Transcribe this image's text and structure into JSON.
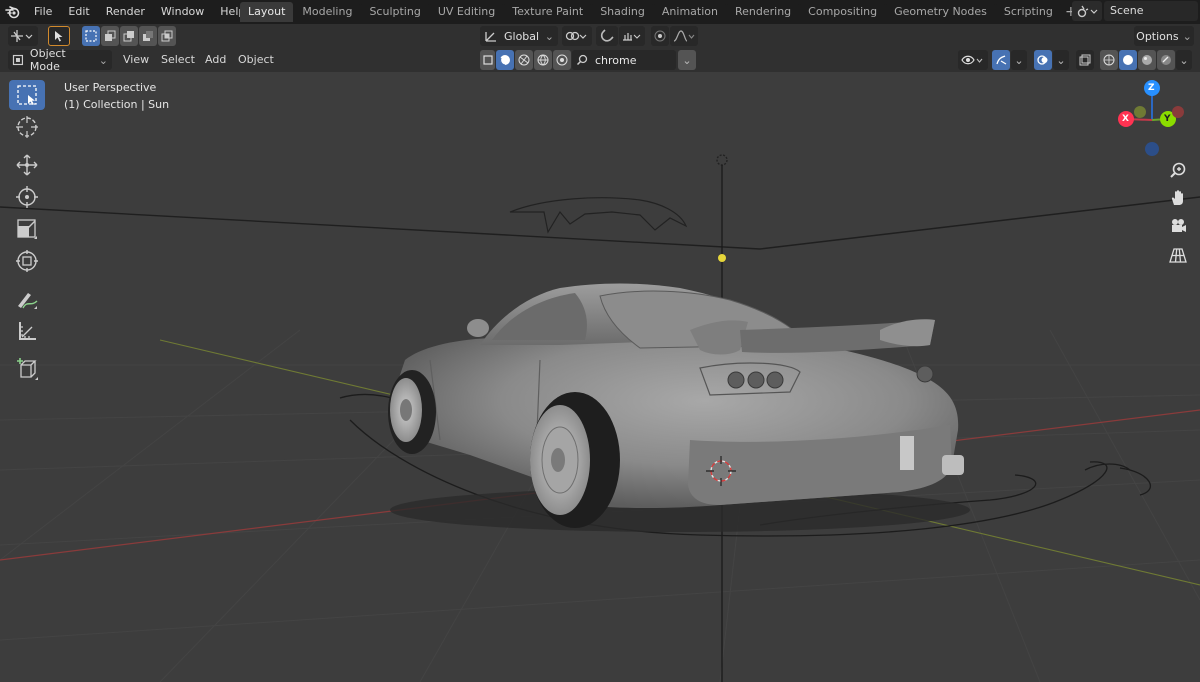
{
  "topbar": {
    "menus": [
      "File",
      "Edit",
      "Render",
      "Window",
      "Help"
    ],
    "tabs": [
      "Layout",
      "Modeling",
      "Sculpting",
      "UV Editing",
      "Texture Paint",
      "Shading",
      "Animation",
      "Rendering",
      "Compositing",
      "Geometry Nodes",
      "Scripting"
    ],
    "active_tab": "Layout",
    "add_tab": "+",
    "scene": "Scene"
  },
  "header": {
    "orientation": "Global",
    "options": "Options",
    "mode": "Object Mode",
    "menus": [
      "View",
      "Select",
      "Add",
      "Object"
    ],
    "search_value": "chrome"
  },
  "viewport": {
    "perspective": "User Perspective",
    "collection": "(1) Collection | Sun"
  },
  "gizmo": {
    "z": "Z",
    "y": "Y",
    "x": "X"
  },
  "colors": {
    "accent": "#4772b3",
    "x_axis": "#ff3352",
    "y_axis": "#8bdc00",
    "z_axis": "#2890ff",
    "light": "#e6d63a"
  },
  "icons": [
    "blender-logo",
    "select-box-icon",
    "cursor-icon",
    "move-icon",
    "rotate-icon",
    "scale-icon",
    "transform-icon",
    "annotate-icon",
    "measure-icon",
    "add-cube-icon",
    "zoom-icon",
    "hand-icon",
    "camera-icon",
    "grid-icon"
  ]
}
